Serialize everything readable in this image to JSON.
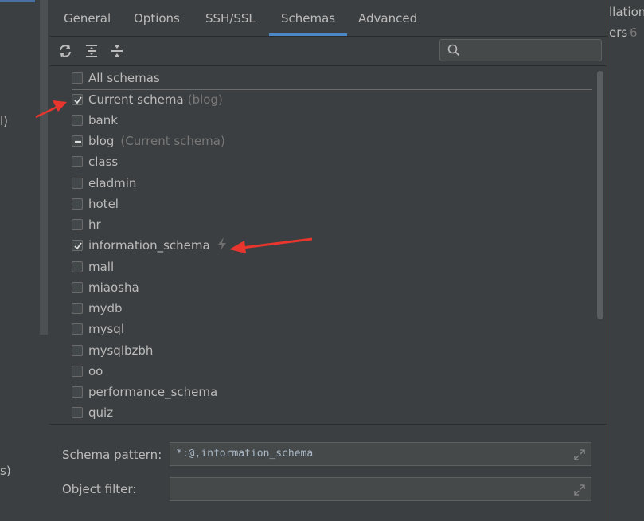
{
  "tabs": [
    {
      "label": "General"
    },
    {
      "label": "Options"
    },
    {
      "label": "SSH/SSL"
    },
    {
      "label": "Schemas"
    },
    {
      "label": "Advanced"
    }
  ],
  "active_tab": "Schemas",
  "left_fragments": [
    "l)",
    "s)"
  ],
  "right_fragments": {
    "line1": "llations",
    "line2": "ers",
    "count": "6"
  },
  "search": {
    "placeholder": ""
  },
  "schemas": [
    {
      "label": "All schemas",
      "state": "unchecked",
      "hint": ""
    },
    {
      "label": "Current schema",
      "state": "checked",
      "hint": "(blog)"
    },
    {
      "label": "bank",
      "state": "unchecked",
      "hint": ""
    },
    {
      "label": "blog",
      "state": "partial",
      "hint": "(Current schema)"
    },
    {
      "label": "class",
      "state": "unchecked",
      "hint": ""
    },
    {
      "label": "eladmin",
      "state": "unchecked",
      "hint": ""
    },
    {
      "label": "hotel",
      "state": "unchecked",
      "hint": ""
    },
    {
      "label": "hr",
      "state": "unchecked",
      "hint": ""
    },
    {
      "label": "information_schema",
      "state": "checked",
      "hint": ""
    },
    {
      "label": "mall",
      "state": "unchecked",
      "hint": ""
    },
    {
      "label": "miaosha",
      "state": "unchecked",
      "hint": ""
    },
    {
      "label": "mydb",
      "state": "unchecked",
      "hint": ""
    },
    {
      "label": "mysql",
      "state": "unchecked",
      "hint": ""
    },
    {
      "label": "mysqlbzbh",
      "state": "unchecked",
      "hint": ""
    },
    {
      "label": "oo",
      "state": "unchecked",
      "hint": ""
    },
    {
      "label": "performance_schema",
      "state": "unchecked",
      "hint": ""
    },
    {
      "label": "quiz",
      "state": "unchecked",
      "hint": ""
    }
  ],
  "schema_pattern": {
    "label": "Schema pattern:",
    "value": "*:@,information_schema"
  },
  "object_filter": {
    "label": "Object filter:",
    "value": ""
  },
  "colors": {
    "accent": "#4a88c7",
    "annotation_arrow": "#e8362e"
  }
}
